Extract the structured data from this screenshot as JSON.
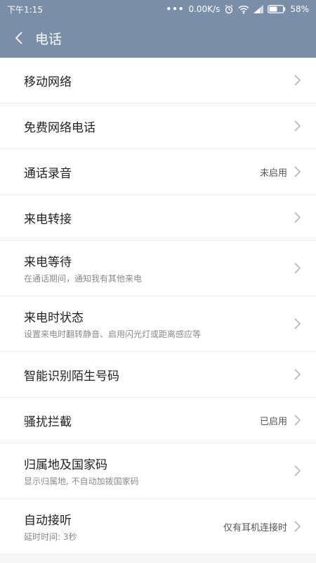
{
  "status_bar": {
    "time": "下午1:15",
    "dots": "•••",
    "network_speed": "0.00K/s",
    "battery": "58%",
    "icons": [
      "alarm-icon",
      "wifi-icon",
      "signal-icon",
      "battery-icon"
    ]
  },
  "app_bar": {
    "title": "电话",
    "back_icon": "chevron-left-icon"
  },
  "colors": {
    "header": "#7a8ea8",
    "background": "#f7f7f7",
    "subtitle": "#8a8a8a"
  },
  "settings": [
    {
      "title": "移动网络",
      "subtitle": "",
      "value": ""
    },
    {
      "title": "免费网络电话",
      "subtitle": "",
      "value": ""
    },
    {
      "title": "通话录音",
      "subtitle": "",
      "value": "未启用"
    },
    {
      "title": "来电转接",
      "subtitle": "",
      "value": ""
    },
    {
      "title": "来电等待",
      "subtitle": "在通话期间，通知我有其他来电",
      "value": ""
    },
    {
      "title": "来电时状态",
      "subtitle": "设置来电时翻转静音、启用闪光灯或距离感应等",
      "value": ""
    },
    {
      "title": "智能识别陌生号码",
      "subtitle": "",
      "value": ""
    },
    {
      "title": "骚扰拦截",
      "subtitle": "",
      "value": "已启用"
    },
    {
      "title": "归属地及国家码",
      "subtitle": "显示归属地, 不自动加拨国家码",
      "value": ""
    },
    {
      "title": "自动接听",
      "subtitle": "延时时间: 3秒",
      "value": "仅有耳机连接时"
    }
  ]
}
